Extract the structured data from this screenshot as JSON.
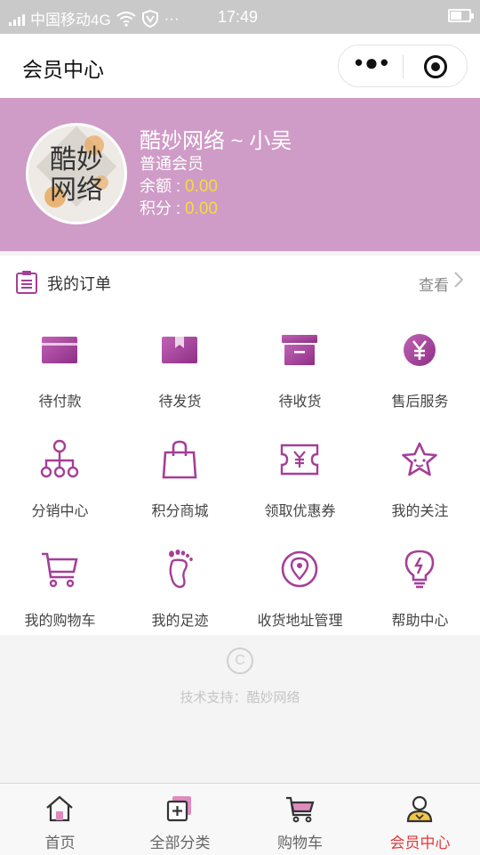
{
  "status_bar": {
    "carrier": "中国移动4G",
    "dots": "···",
    "time": "17:49"
  },
  "nav": {
    "title": "会员中心"
  },
  "profile": {
    "avatar_text_line1": "酷妙",
    "avatar_text_line2": "网络",
    "name": "酷妙网络 ~ 小吴",
    "level": "普通会员",
    "balance_label": "余额 : ",
    "balance_value": "0.00",
    "points_label": "积分 : ",
    "points_value": "0.00"
  },
  "orders": {
    "title": "我的订单",
    "view_label": "查看",
    "items": [
      {
        "label": "待付款",
        "icon": "card-icon"
      },
      {
        "label": "待发货",
        "icon": "box-icon"
      },
      {
        "label": "待收货",
        "icon": "archive-icon"
      },
      {
        "label": "售后服务",
        "icon": "yen-circle-icon"
      },
      {
        "label": "分销中心",
        "icon": "hierarchy-icon"
      },
      {
        "label": "积分商城",
        "icon": "shopping-bag-icon"
      },
      {
        "label": "领取优惠券",
        "icon": "coupon-icon"
      },
      {
        "label": "我的关注",
        "icon": "star-icon"
      },
      {
        "label": "我的购物车",
        "icon": "cart-icon"
      },
      {
        "label": "我的足迹",
        "icon": "footprint-icon"
      },
      {
        "label": "收货地址管理",
        "icon": "location-pin-icon"
      },
      {
        "label": "帮助中心",
        "icon": "lightbulb-icon"
      }
    ]
  },
  "footer": {
    "copyright_symbol": "C",
    "credit": "技术支持：酷妙网络"
  },
  "tabbar": {
    "tabs": [
      {
        "label": "首页",
        "icon": "home-icon"
      },
      {
        "label": "全部分类",
        "icon": "category-icon"
      },
      {
        "label": "购物车",
        "icon": "cart-icon"
      },
      {
        "label": "会员中心",
        "icon": "member-icon",
        "active": true
      }
    ]
  },
  "colors": {
    "accent_purple": "#a53f97",
    "header_bg": "#cf9bc7",
    "balance_yellow": "#f5dd3a",
    "active_tab": "#e4393c"
  }
}
